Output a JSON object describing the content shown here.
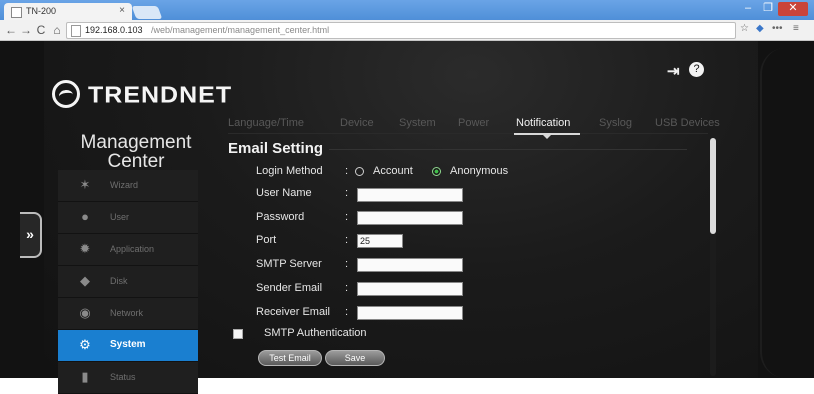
{
  "browser": {
    "tab_title": "TN-200",
    "tab_close": "×",
    "url_host": "192.168.0.103",
    "url_path": "/web/management/management_center.html",
    "win_min": "–",
    "win_max": "❐",
    "win_close": "✕"
  },
  "header": {
    "logo_text": "TRENDNET",
    "help_label": "?"
  },
  "sidebar": {
    "title_line1": "Management",
    "title_line2": "Center",
    "toggle": "»",
    "items": [
      {
        "label": "Wizard",
        "icon": "wand-icon",
        "active": false
      },
      {
        "label": "User",
        "icon": "user-icon",
        "active": false
      },
      {
        "label": "Application",
        "icon": "gear-icon",
        "active": false
      },
      {
        "label": "Disk",
        "icon": "disk-icon",
        "active": false
      },
      {
        "label": "Network",
        "icon": "network-icon",
        "active": false
      },
      {
        "label": "System",
        "icon": "system-icon",
        "active": true
      },
      {
        "label": "Status",
        "icon": "status-icon",
        "active": false
      }
    ]
  },
  "tabs": [
    {
      "label": "Language/Time",
      "active": false
    },
    {
      "label": "Device",
      "active": false
    },
    {
      "label": "System",
      "active": false
    },
    {
      "label": "Power",
      "active": false
    },
    {
      "label": "Notification",
      "active": true
    },
    {
      "label": "Syslog",
      "active": false
    },
    {
      "label": "USB Devices",
      "active": false
    }
  ],
  "email": {
    "section_title": "Email Setting",
    "login_method_label": "Login Method",
    "login_method_options": [
      "Account",
      "Anonymous"
    ],
    "login_method_selected": "Anonymous",
    "user_name_label": "User Name",
    "user_name_value": "",
    "password_label": "Password",
    "password_value": "",
    "port_label": "Port",
    "port_value": "25",
    "smtp_server_label": "SMTP Server",
    "smtp_server_value": "",
    "sender_email_label": "Sender Email",
    "sender_email_value": "",
    "receiver_email_label": "Receiver Email",
    "receiver_email_value": "",
    "smtp_auth_label": "SMTP Authentication",
    "smtp_auth_checked": false,
    "test_button": "Test Email",
    "save_button": "Save"
  },
  "colors": {
    "accent": "#1a7fd0",
    "background": "#121212",
    "radio_selected": "#3fc04a"
  }
}
